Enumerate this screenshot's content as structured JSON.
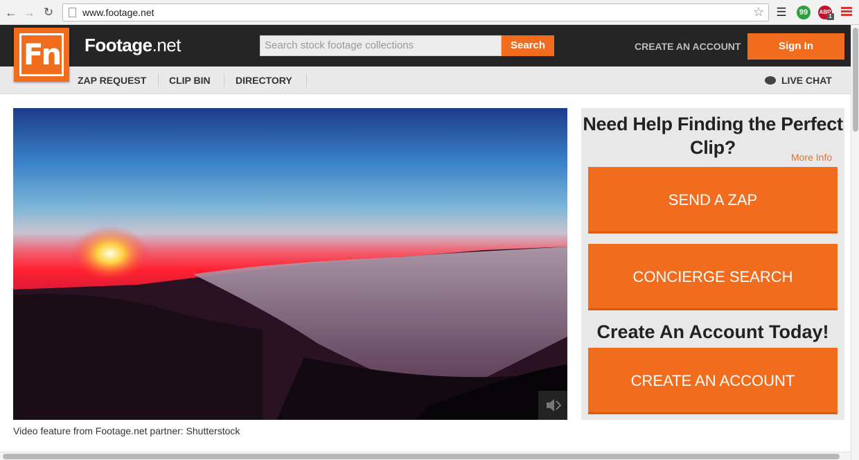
{
  "browser": {
    "url": "www.footage.net",
    "extensions": {
      "hangouts_glyph": "99",
      "abp_label": "ABP",
      "abp_count": "1"
    }
  },
  "header": {
    "logo_text": "Fn",
    "brand_name": "Footage",
    "brand_suffix": ".net",
    "search_placeholder": "Search stock footage collections",
    "search_button": "Search",
    "create_account": "CREATE AN ACCOUNT",
    "sign_in": "Sign In"
  },
  "subnav": {
    "items": [
      {
        "label": "ZAP REQUEST"
      },
      {
        "label": "CLIP BIN"
      },
      {
        "label": "DIRECTORY"
      }
    ],
    "live_chat": "LIVE CHAT"
  },
  "main": {
    "video_caption": "Video feature from Footage.net partner: Shutterstock"
  },
  "sidebar": {
    "help_title": "Need Help Finding the Perfect Clip?",
    "more_info": "More Info",
    "send_zap": "SEND A ZAP",
    "concierge_search": "CONCIERGE SEARCH",
    "account_title": "Create An Account Today!",
    "create_account": "CREATE AN ACCOUNT"
  },
  "colors": {
    "accent": "#f26c1e",
    "header_bg": "#252525",
    "subnav_bg": "#e9e9e9",
    "sidebar_bg": "#e8e8e8"
  },
  "icons": [
    "back-arrow-icon",
    "forward-arrow-icon",
    "reload-icon",
    "page-icon",
    "star-icon",
    "buffer-icon",
    "hangouts-icon",
    "adblock-icon",
    "menu-icon",
    "chat-bubble-icon",
    "volume-icon"
  ]
}
